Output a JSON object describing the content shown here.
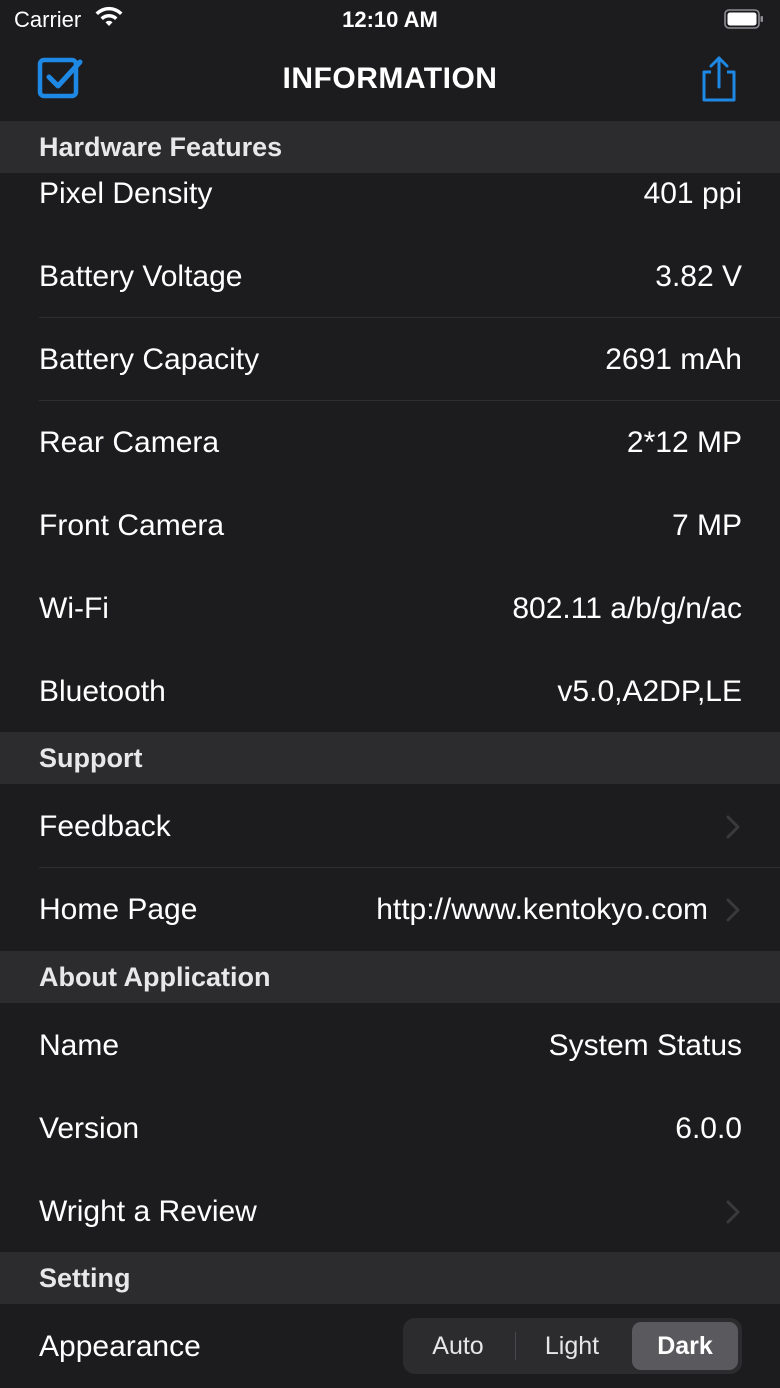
{
  "status_bar": {
    "carrier": "Carrier",
    "time": "12:10 AM"
  },
  "nav": {
    "title": "INFORMATION",
    "left_icon": "checkbox-icon",
    "right_icon": "share-icon",
    "accent_color": "#1e88e5"
  },
  "sections": {
    "hardware": {
      "title": "Hardware Features",
      "rows": [
        {
          "label": "Pixel Density",
          "value": "401 ppi"
        },
        {
          "label": "Battery Voltage",
          "value": "3.82 V"
        },
        {
          "label": "Battery Capacity",
          "value": "2691 mAh"
        },
        {
          "label": "Rear Camera",
          "value": "2*12 MP"
        },
        {
          "label": "Front Camera",
          "value": "7 MP"
        },
        {
          "label": "Wi-Fi",
          "value": "802.11 a/b/g/n/ac"
        },
        {
          "label": "Bluetooth",
          "value": "v5.0,A2DP,LE"
        }
      ]
    },
    "support": {
      "title": "Support",
      "rows": [
        {
          "label": "Feedback",
          "value": ""
        },
        {
          "label": "Home Page",
          "value": "http://www.kentokyo.com"
        }
      ]
    },
    "about": {
      "title": "About Application",
      "rows": [
        {
          "label": "Name",
          "value": "System Status"
        },
        {
          "label": "Version",
          "value": "6.0.0"
        },
        {
          "label": "Wright a Review",
          "value": ""
        }
      ]
    },
    "setting": {
      "title": "Setting",
      "appearance": {
        "label": "Appearance",
        "options": [
          "Auto",
          "Light",
          "Dark"
        ],
        "selected": "Dark"
      }
    }
  }
}
